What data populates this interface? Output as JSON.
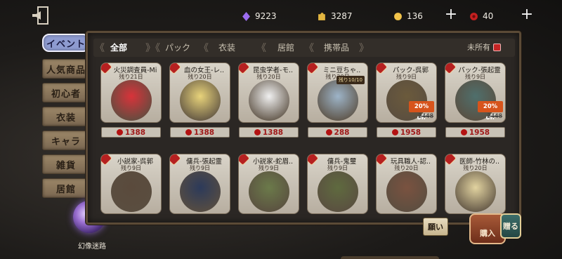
{
  "currencies": [
    {
      "name": "purple-gem",
      "value": "9223",
      "color": "#9b6cf0"
    },
    {
      "name": "clue-coin",
      "value": "3287",
      "color": "#e3b640"
    },
    {
      "name": "echo-coin",
      "value": "136",
      "color": "#f2c34a"
    },
    {
      "name": "red-coin",
      "value": "40",
      "color": "#c42020"
    }
  ],
  "side_tabs": [
    "イベント",
    "人気商品",
    "初心者",
    "衣装",
    "キャラ",
    "雑貨",
    "居館"
  ],
  "filter_tabs": [
    "全部",
    "パック",
    "衣装",
    "居館",
    "携帯品"
  ],
  "owned_label": "未所有",
  "orb_label": "幻像迷路",
  "buttons": {
    "hint": "願い",
    "buy": "購入",
    "gift": "贈る"
  },
  "products": [
    {
      "name": "火災調査員-Mi",
      "sub": "残り21日",
      "price": "1388",
      "art_color": "#d8333a"
    },
    {
      "name": "血の女王-レ..",
      "sub": "残り20日",
      "price": "1388",
      "art_color": "#e8d37a"
    },
    {
      "name": "昆虫学者-モ..",
      "sub": "残り20日",
      "price": "1388",
      "art_color": "#f0f0f0"
    },
    {
      "name": "ミニ豆ちゃ..",
      "sub": "残り20日",
      "limit": "残り10/10",
      "price": "288",
      "art_color": "#9db4c8"
    },
    {
      "name": "パック-呉郭",
      "sub": "残り9日",
      "price": "1958",
      "old_price": "2448",
      "discount": "20% off",
      "art_color": "#6b5a3c"
    },
    {
      "name": "パック-張起霊",
      "sub": "残り9日",
      "price": "1958",
      "old_price": "2448",
      "discount": "20% off",
      "art_color": "#4f6f6c"
    },
    {
      "name": "小説家-呉郭",
      "sub": "残り9日",
      "art_color": "#5a4a3c"
    },
    {
      "name": "傭兵-張起霊",
      "sub": "残り9日",
      "art_color": "#2c3a5a"
    },
    {
      "name": "小説家-蛇眉..",
      "sub": "残り9日",
      "art_color": "#6b7a4a"
    },
    {
      "name": "傭兵-鬼璽",
      "sub": "残り9日",
      "art_color": "#5f6a3f"
    },
    {
      "name": "玩具職人-認..",
      "sub": "残り20日",
      "art_color": "#7a5240"
    },
    {
      "name": "医師-竹林の..",
      "sub": "残り20日",
      "art_color": "#e2d3a0"
    }
  ]
}
